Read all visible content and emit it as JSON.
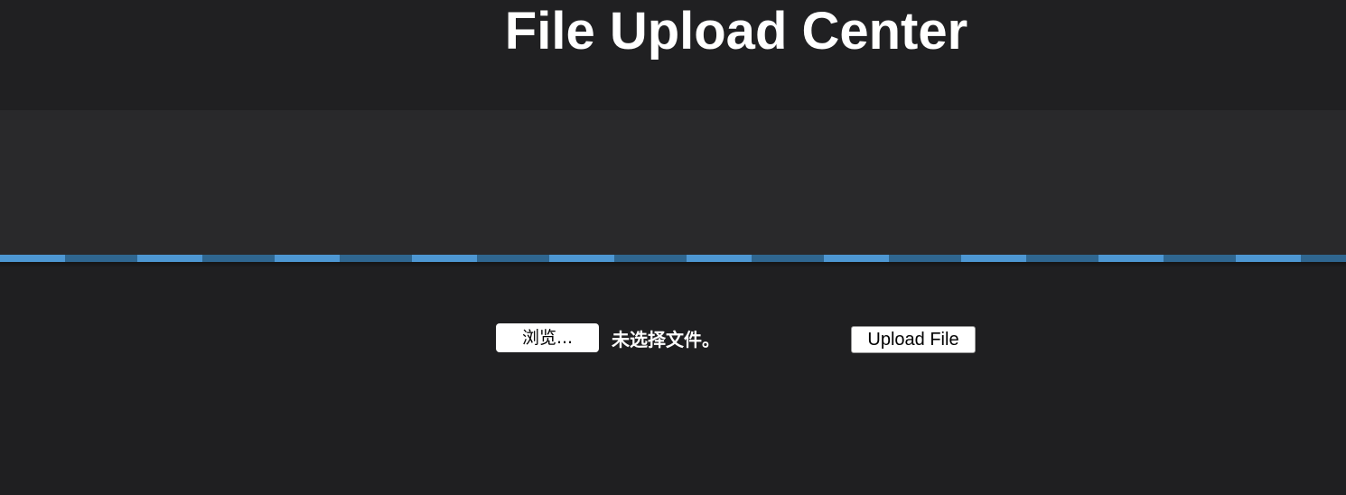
{
  "header": {
    "title": "File Upload Center"
  },
  "upload_form": {
    "browse_label": "浏览...",
    "file_status": "未选择文件。",
    "submit_label": "Upload File"
  },
  "colors": {
    "background": "#1f1f21",
    "band": "#29292b",
    "stripe_light": "#4d97d3",
    "stripe_dark": "#2f6690",
    "text": "#ffffff"
  }
}
